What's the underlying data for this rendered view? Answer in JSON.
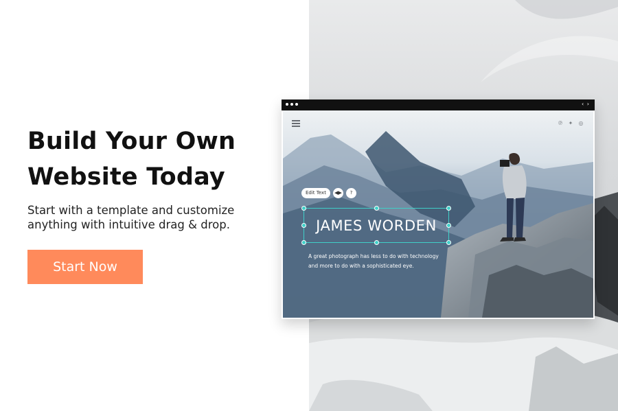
{
  "promo": {
    "headline_line1": "Build Your Own",
    "headline_line2": "Website Today",
    "subtext_line1": "Start with a template and customize",
    "subtext_line2": "anything with intuitive drag & drop.",
    "cta_label": "Start Now"
  },
  "mockup": {
    "browser_nav": "‹ ›",
    "social_icons": [
      "pinterest-icon",
      "twitter-icon",
      "instagram-icon"
    ],
    "toolbar": {
      "edit_text_label": "Edit Text"
    },
    "hero_title": "JAMES WORDEN",
    "tagline_line1": "A great photograph has less to do with technology",
    "tagline_line2": "and more to do with a sophisticated eye."
  },
  "colors": {
    "cta": "#ff8a5b",
    "selection": "#3fd0c9",
    "browser_bar": "#111111"
  }
}
